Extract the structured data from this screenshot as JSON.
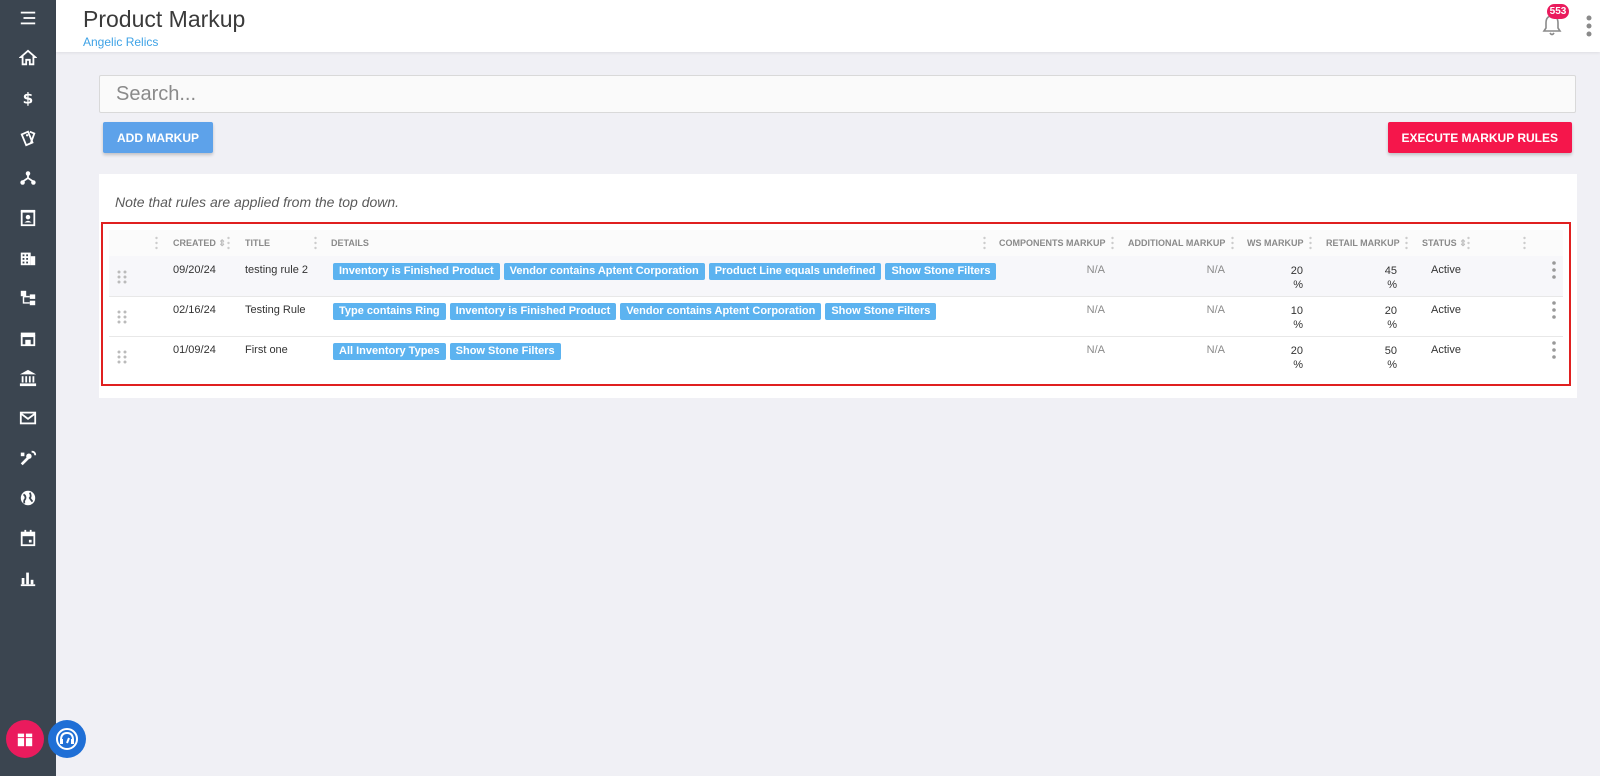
{
  "header": {
    "title": "Product Markup",
    "company": "Angelic Relics",
    "notification_count": "553"
  },
  "search": {
    "placeholder": "Search..."
  },
  "actions": {
    "add_label": "ADD MARKUP",
    "execute_label": "EXECUTE MARKUP RULES"
  },
  "note": "Note that rules are applied from the top down.",
  "table": {
    "columns": {
      "created": "CREATED",
      "title": "TITLE",
      "details": "DETAILS",
      "components": "COMPONENTS MARKUP",
      "additional": "ADDITIONAL MARKUP",
      "ws": "WS MARKUP",
      "retail": "RETAIL MARKUP",
      "status": "STATUS"
    },
    "rows": [
      {
        "created": "09/20/24",
        "title": "testing rule 2",
        "tags": [
          "Inventory is Finished Product",
          "Vendor contains Aptent Corporation",
          "Product Line equals undefined",
          "Show Stone Filters"
        ],
        "components": "N/A",
        "additional": "N/A",
        "ws": "20",
        "retail": "45",
        "unit": "%",
        "status": "Active"
      },
      {
        "created": "02/16/24",
        "title": "Testing Rule",
        "tags": [
          "Type contains Ring",
          "Inventory is Finished Product",
          "Vendor contains Aptent Corporation",
          "Show Stone Filters"
        ],
        "components": "N/A",
        "additional": "N/A",
        "ws": "10",
        "retail": "20",
        "unit": "%",
        "status": "Active"
      },
      {
        "created": "01/09/24",
        "title": "First one",
        "tags": [
          "All Inventory Types",
          "Show Stone Filters"
        ],
        "components": "N/A",
        "additional": "N/A",
        "ws": "20",
        "retail": "50",
        "unit": "%",
        "status": "Active"
      }
    ]
  },
  "sidebar": {
    "icons": [
      "menu-icon",
      "home-icon",
      "dollar-icon",
      "tags-icon",
      "network-icon",
      "contacts-icon",
      "building-icon",
      "hierarchy-icon",
      "store-icon",
      "bank-icon",
      "mail-icon",
      "tools-icon",
      "globe-icon",
      "calendar-icon",
      "bar-chart-icon"
    ]
  },
  "colors": {
    "sidebar": "#3b4550",
    "primary": "#5da2ea",
    "danger": "#f5164b",
    "tag": "#5cb3f0",
    "badge": "#ea1b5d",
    "highlight": "#e02020"
  }
}
